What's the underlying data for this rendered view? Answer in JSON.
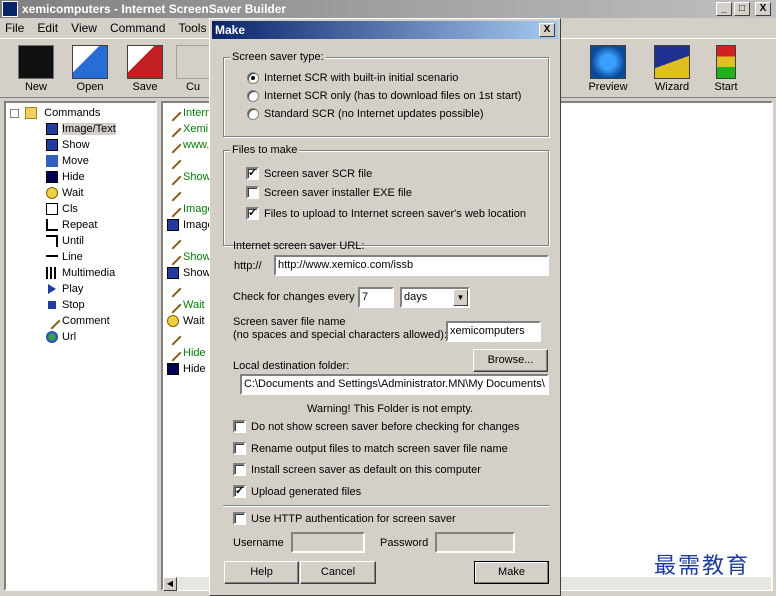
{
  "window": {
    "title": "xemicomputers - Internet ScreenSaver Builder",
    "min": "_",
    "max": "□",
    "close": "X"
  },
  "menu": [
    "File",
    "Edit",
    "View",
    "Command",
    "Tools",
    "He"
  ],
  "toolbar": {
    "new": "New",
    "open": "Open",
    "save": "Save",
    "cut": "Cu",
    "preview": "Preview",
    "wizard": "Wizard",
    "start": "Start"
  },
  "tree": {
    "root": "Commands",
    "items": [
      "Image/Text",
      "Show",
      "Move",
      "Hide",
      "Wait",
      "Cls",
      "Repeat",
      "Until",
      "Line",
      "Multimedia",
      "Play",
      "Stop",
      "Comment",
      "Url"
    ]
  },
  "script_rows": [
    "Intern",
    "Xemi",
    "www.",
    "",
    "Show",
    "",
    "Image",
    "Image",
    "",
    "Show",
    "Show",
    "",
    "Wait",
    "Wait",
    "",
    "Hide",
    "Hide"
  ],
  "dialog": {
    "title": "Make",
    "close": "X",
    "type_group": "Screen saver type:",
    "type_opts": [
      "Internet SCR with built-in initial scenario",
      "Internet SCR only (has to download files on 1st start)",
      "Standard SCR (no Internet updates possible)"
    ],
    "files_group": "Files to make",
    "files_opts": [
      "Screen saver SCR file",
      "Screen saver installer EXE file",
      "Files to upload to Internet screen saver's web location"
    ],
    "url_label": "Internet screen saver URL:",
    "url_prefix": "http://",
    "url_value": "http://www.xemico.com/issb",
    "check_label": "Check for changes every",
    "check_value": "7",
    "check_unit": "days",
    "filename_label1": "Screen saver file name",
    "filename_label2": "(no spaces and special characters allowed):",
    "filename_value": "xemicomputers",
    "dest_label": "Local destination folder:",
    "browse": "Browse...",
    "dest_value": "C:\\Documents and Settings\\Administrator.MN\\My Documents\\",
    "warning": "Warning! This Folder is not empty.",
    "opts": [
      "Do not show screen saver before checking for changes",
      "Rename output files to match screen saver file name",
      "Install screen saver as default on this computer",
      "Upload generated files"
    ],
    "http_auth": "Use HTTP authentication for screen saver",
    "username": "Username",
    "password": "Password",
    "help": "Help",
    "cancel": "Cancel",
    "make": "Make"
  },
  "watermark": "最需教育",
  "colors": {
    "title_active": "#0a246a",
    "face": "#d4d0c8"
  }
}
